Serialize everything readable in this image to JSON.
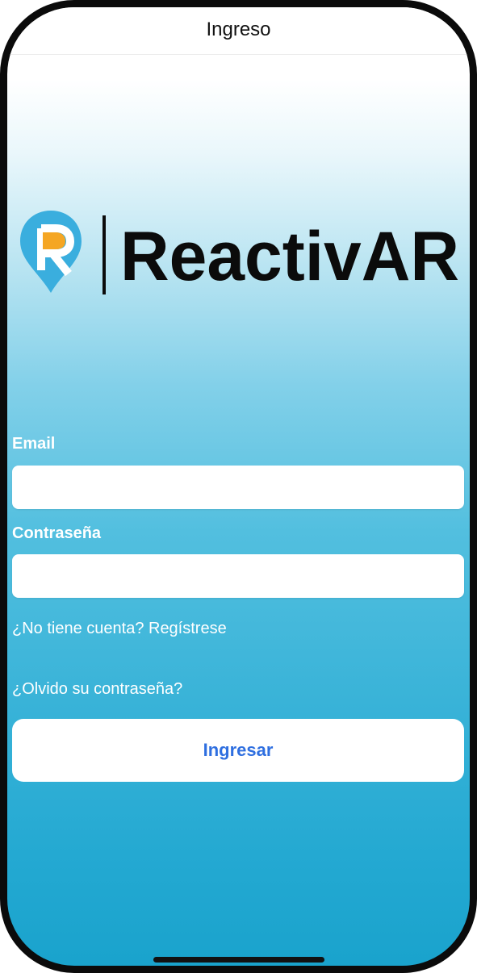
{
  "nav": {
    "title": "Ingreso"
  },
  "logo": {
    "wordmark": "ReactivAR",
    "icon_letter": "R"
  },
  "form": {
    "email_label": "Email",
    "email_value": "",
    "password_label": "Contraseña",
    "password_value": "",
    "register_link": "¿No tiene cuenta? Regístrese",
    "forgot_link": "¿Olvido su contraseña?",
    "submit_label": "Ingresar"
  },
  "colors": {
    "accent": "#2f6fe0",
    "gradient_bottom": "#18a2cc",
    "logo_blue": "#3aaede",
    "logo_orange": "#f5a623"
  }
}
